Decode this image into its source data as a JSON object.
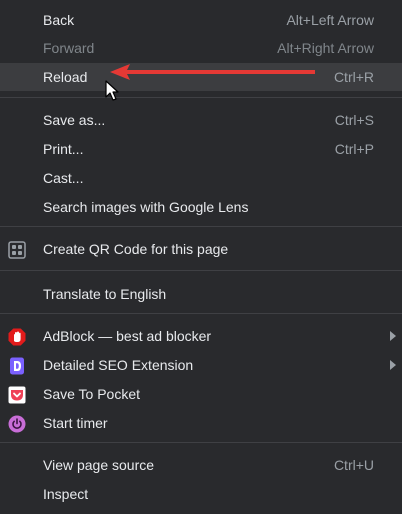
{
  "menu": {
    "items": [
      {
        "label": "Back",
        "shortcut": "Alt+Left Arrow"
      },
      {
        "label": "Forward",
        "shortcut": "Alt+Right Arrow"
      },
      {
        "label": "Reload",
        "shortcut": "Ctrl+R"
      },
      {
        "label": "Save as...",
        "shortcut": "Ctrl+S"
      },
      {
        "label": "Print...",
        "shortcut": "Ctrl+P"
      },
      {
        "label": "Cast..."
      },
      {
        "label": "Search images with Google Lens"
      },
      {
        "label": "Create QR Code for this page"
      },
      {
        "label": "Translate to English"
      },
      {
        "label": "AdBlock — best ad blocker"
      },
      {
        "label": "Detailed SEO Extension"
      },
      {
        "label": "Save To Pocket"
      },
      {
        "label": "Start timer"
      },
      {
        "label": "View page source",
        "shortcut": "Ctrl+U"
      },
      {
        "label": "Inspect"
      }
    ]
  },
  "icons": {
    "qr": "qr-code-icon",
    "adblock": "adblock-hand-icon",
    "seo": "detailed-seo-icon",
    "pocket": "pocket-icon",
    "timer": "timer-power-icon"
  },
  "colors": {
    "menu_bg": "#292a2d",
    "highlight_bg": "#3c3d40",
    "text": "#e8eaed",
    "shortcut": "#9aa0a6",
    "disabled": "#80868b",
    "annotation_arrow": "#e53935",
    "adblock_red": "#e21b1b",
    "seo_purple": "#7b61ff",
    "pocket_red": "#ef4056",
    "timer_pink": "#c86dd7"
  }
}
